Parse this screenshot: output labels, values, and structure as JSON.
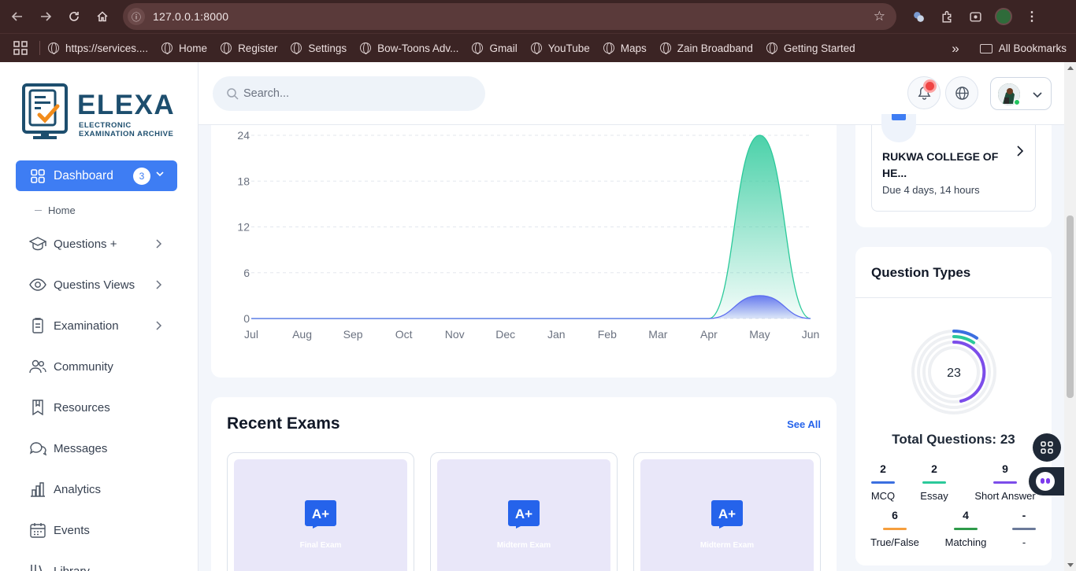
{
  "browser": {
    "url": "127.0.0.1:8000",
    "bookmarks": [
      {
        "label": "https://services...."
      },
      {
        "label": "Home"
      },
      {
        "label": "Register"
      },
      {
        "label": "Settings"
      },
      {
        "label": "Bow-Toons Adv..."
      },
      {
        "label": "Gmail"
      },
      {
        "label": "YouTube"
      },
      {
        "label": "Maps"
      },
      {
        "label": "Zain Broadband"
      },
      {
        "label": "Getting Started"
      }
    ],
    "all_bookmarks": "All Bookmarks",
    "more_bookmarks": "»"
  },
  "logo": {
    "title": "ELEXA",
    "subtitle": "ELECTRONIC EXAMINATION ARCHIVE"
  },
  "sidebar": {
    "dashboard": {
      "label": "Dashboard",
      "badge": "3"
    },
    "home_link": "Home",
    "items": [
      {
        "label": "Questions +",
        "icon": "graduation-cap-icon",
        "has_chevron": true
      },
      {
        "label": "Questins Views",
        "icon": "eye-icon",
        "has_chevron": true
      },
      {
        "label": "Examination",
        "icon": "clipboard-icon",
        "has_chevron": true
      },
      {
        "label": "Community",
        "icon": "users-icon",
        "has_chevron": false
      },
      {
        "label": "Resources",
        "icon": "bookmark-icon",
        "has_chevron": false
      },
      {
        "label": "Messages",
        "icon": "chat-icon",
        "has_chevron": false
      },
      {
        "label": "Analytics",
        "icon": "bar-chart-icon",
        "has_chevron": false
      },
      {
        "label": "Events",
        "icon": "calendar-icon",
        "has_chevron": false
      },
      {
        "label": "Library",
        "icon": "library-icon",
        "has_chevron": false
      }
    ]
  },
  "header": {
    "search_placeholder": "Search..."
  },
  "chart_data": {
    "type": "area",
    "categories": [
      "Jul",
      "Aug",
      "Sep",
      "Oct",
      "Nov",
      "Dec",
      "Jan",
      "Feb",
      "Mar",
      "Apr",
      "May",
      "Jun"
    ],
    "series": [
      {
        "values": [
          0,
          0,
          0,
          0,
          0,
          0,
          0,
          0,
          0,
          0,
          24,
          0
        ],
        "color": "#2bc99a"
      },
      {
        "values": [
          0,
          0,
          0,
          0,
          0,
          0,
          0,
          0,
          0,
          0,
          3,
          0
        ],
        "color": "#5b6cf0"
      }
    ],
    "yticks": [
      "0",
      "6",
      "12",
      "18",
      "24"
    ],
    "ylim": [
      0,
      24
    ],
    "grid": true
  },
  "recent_exams": {
    "title": "Recent Exams",
    "see_all": "See All",
    "items": [
      {
        "name": "Final Exam"
      },
      {
        "name": "Midterm Exam"
      },
      {
        "name": "Midterm Exam"
      }
    ]
  },
  "college": {
    "name": "RUKWA COLLEGE OF HE...",
    "due": "Due 4 days, 14 hours"
  },
  "question_types": {
    "title": "Question Types",
    "total_label": "Total Questions:",
    "total": "23",
    "stats": [
      {
        "value": "2",
        "label": "MCQ",
        "color": "#3b6fe0"
      },
      {
        "value": "2",
        "label": "Essay",
        "color": "#2bc99a"
      },
      {
        "value": "9",
        "label": "Short Answer",
        "color": "#7c4dea"
      },
      {
        "value": "6",
        "label": "True/False",
        "color": "#f59e3d"
      },
      {
        "value": "4",
        "label": "Matching",
        "color": "#2e9a4a"
      },
      {
        "value": "-",
        "label": "-",
        "color": "#6b7a99"
      }
    ]
  }
}
